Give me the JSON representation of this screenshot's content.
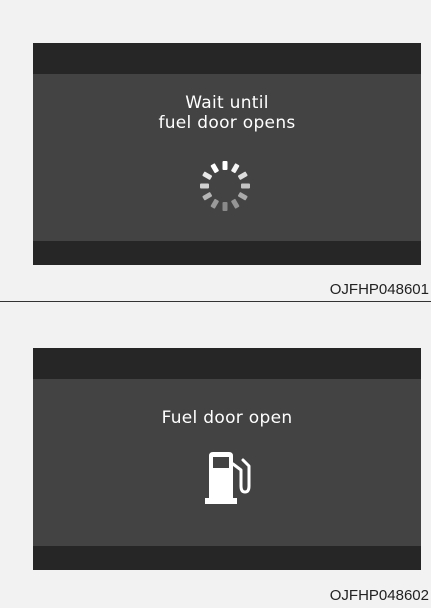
{
  "panels": [
    {
      "message_line1": "Wait until",
      "message_line2": "fuel door opens",
      "icon": "loading-spinner-icon",
      "code": "OJFHP048601"
    },
    {
      "message": "Fuel door open",
      "icon": "fuel-pump-icon",
      "code": "OJFHP048602"
    }
  ],
  "colors": {
    "page_background": "#f2f2f2",
    "screen_background": "#434343",
    "bar_background": "#262626",
    "text": "#ffffff"
  }
}
